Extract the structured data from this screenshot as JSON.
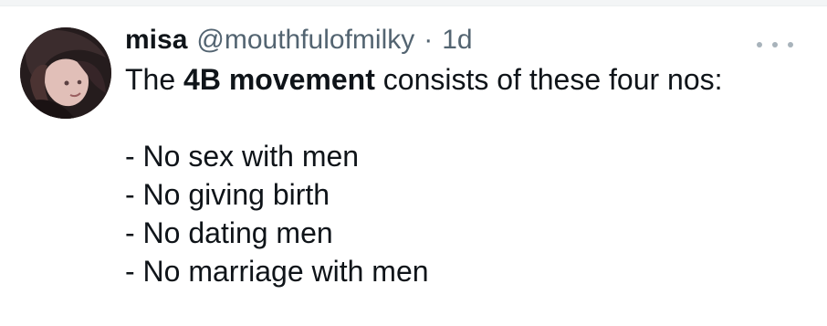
{
  "tweet": {
    "display_name": "misa",
    "handle": "@mouthfulofmilky",
    "separator": "·",
    "time": "1d",
    "more_icon": "more-dots-icon",
    "text_prefix": "The ",
    "text_bold": "4B movement",
    "text_suffix": " consists of these four nos:",
    "list": [
      "- No sex with men",
      "- No giving birth",
      "- No dating men",
      "- No marriage with men"
    ]
  }
}
